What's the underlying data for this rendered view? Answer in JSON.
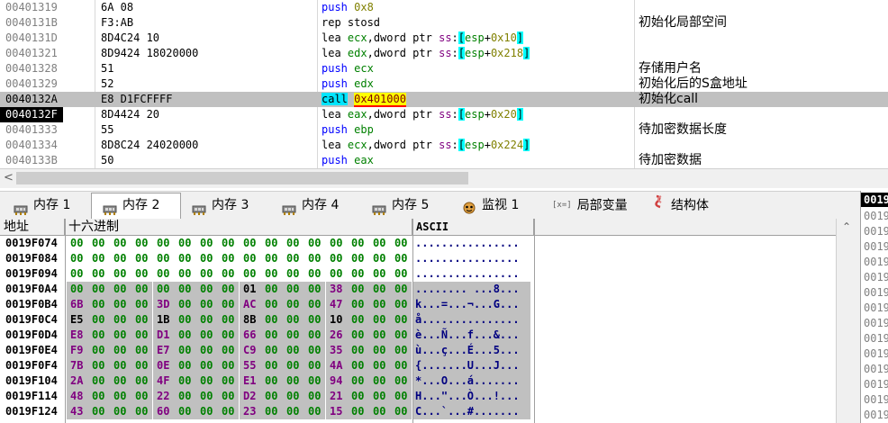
{
  "disasm": {
    "rows": [
      {
        "addr": "00401319",
        "bytes": "6A 08",
        "mn": "push",
        "ops": [
          [
            "num",
            "0x8"
          ]
        ],
        "comment": ""
      },
      {
        "addr": "0040131B",
        "bytes": "F3:AB",
        "mn": "rep stosd",
        "ops": [],
        "comment": "初始化局部空间"
      },
      {
        "addr": "0040131D",
        "bytes": "8D4C24 10",
        "mn": "lea",
        "ops": [
          [
            "reg",
            "ecx"
          ],
          [
            "k",
            ",dword ptr "
          ],
          [
            "seg",
            "ss"
          ],
          [
            "k",
            ":"
          ],
          [
            "br",
            "["
          ],
          [
            "reg",
            "esp"
          ],
          [
            "k",
            "+"
          ],
          [
            "num",
            "0x10"
          ],
          [
            "br",
            "]"
          ]
        ],
        "comment": ""
      },
      {
        "addr": "00401321",
        "bytes": "8D9424 18020000",
        "mn": "lea",
        "ops": [
          [
            "reg",
            "edx"
          ],
          [
            "k",
            ",dword ptr "
          ],
          [
            "seg",
            "ss"
          ],
          [
            "k",
            ":"
          ],
          [
            "br",
            "["
          ],
          [
            "reg",
            "esp"
          ],
          [
            "k",
            "+"
          ],
          [
            "num",
            "0x218"
          ],
          [
            "br",
            "]"
          ]
        ],
        "comment": ""
      },
      {
        "addr": "00401328",
        "bytes": "51",
        "mn": "push",
        "ops": [
          [
            "reg",
            "ecx"
          ]
        ],
        "comment": "存储用户名"
      },
      {
        "addr": "00401329",
        "bytes": "52",
        "mn": "push",
        "ops": [
          [
            "reg",
            "edx"
          ]
        ],
        "comment": "初始化后的S盒地址"
      },
      {
        "addr": "0040132A",
        "bytes": "E8 D1FCFFFF",
        "mn": "call",
        "ops": [
          [
            "tgt",
            "0x401000"
          ]
        ],
        "comment": "初始化call"
      },
      {
        "addr": "0040132F",
        "bytes": "8D4424 20",
        "mn": "lea",
        "ops": [
          [
            "reg",
            "eax"
          ],
          [
            "k",
            ",dword ptr "
          ],
          [
            "seg",
            "ss"
          ],
          [
            "k",
            ":"
          ],
          [
            "br",
            "["
          ],
          [
            "reg",
            "esp"
          ],
          [
            "k",
            "+"
          ],
          [
            "num",
            "0x20"
          ],
          [
            "br",
            "]"
          ]
        ],
        "comment": ""
      },
      {
        "addr": "00401333",
        "bytes": "55",
        "mn": "push",
        "ops": [
          [
            "reg",
            "ebp"
          ]
        ],
        "comment": "待加密数据长度"
      },
      {
        "addr": "00401334",
        "bytes": "8D8C24 24020000",
        "mn": "lea",
        "ops": [
          [
            "reg",
            "ecx"
          ],
          [
            "k",
            ",dword ptr "
          ],
          [
            "seg",
            "ss"
          ],
          [
            "k",
            ":"
          ],
          [
            "br",
            "["
          ],
          [
            "reg",
            "esp"
          ],
          [
            "k",
            "+"
          ],
          [
            "num",
            "0x224"
          ],
          [
            "br",
            "]"
          ]
        ],
        "comment": ""
      },
      {
        "addr": "0040133B",
        "bytes": "50",
        "mn": "push",
        "ops": [
          [
            "reg",
            "eax"
          ]
        ],
        "comment": "待加密数据"
      }
    ],
    "selected_index": 6,
    "current_index": 7
  },
  "tabs": [
    {
      "label": "内存 1",
      "icon": "memory-icon",
      "active": false
    },
    {
      "label": "内存 2",
      "icon": "memory-icon",
      "active": true
    },
    {
      "label": "内存 3",
      "icon": "memory-icon",
      "active": false
    },
    {
      "label": "内存 4",
      "icon": "memory-icon",
      "active": false
    },
    {
      "label": "内存 5",
      "icon": "memory-icon",
      "active": false
    },
    {
      "label": "监视 1",
      "icon": "watch-icon",
      "active": false
    },
    {
      "label": "局部变量",
      "icon": "locals-icon",
      "active": false
    },
    {
      "label": "结构体",
      "icon": "struct-icon",
      "active": false
    }
  ],
  "locals_icon_text": "[x=]",
  "dump": {
    "headers": {
      "address": "地址",
      "hex": "十六进制",
      "ascii": "ASCII"
    },
    "rows": [
      {
        "addr": "0019F074",
        "hex": [
          "00",
          "00",
          "00",
          "00",
          "00",
          "00",
          "00",
          "00",
          "00",
          "00",
          "00",
          "00",
          "00",
          "00",
          "00",
          "00"
        ],
        "ascii": "................"
      },
      {
        "addr": "0019F084",
        "hex": [
          "00",
          "00",
          "00",
          "00",
          "00",
          "00",
          "00",
          "00",
          "00",
          "00",
          "00",
          "00",
          "00",
          "00",
          "00",
          "00"
        ],
        "ascii": "................"
      },
      {
        "addr": "0019F094",
        "hex": [
          "00",
          "00",
          "00",
          "00",
          "00",
          "00",
          "00",
          "00",
          "00",
          "00",
          "00",
          "00",
          "00",
          "00",
          "00",
          "00"
        ],
        "ascii": "................"
      },
      {
        "addr": "0019F0A4",
        "hex": [
          "00",
          "00",
          "00",
          "00",
          "00",
          "00",
          "00",
          "00",
          "01",
          "00",
          "00",
          "00",
          "38",
          "00",
          "00",
          "00"
        ],
        "ascii": "........ ...8..."
      },
      {
        "addr": "0019F0B4",
        "hex": [
          "6B",
          "00",
          "00",
          "00",
          "3D",
          "00",
          "00",
          "00",
          "AC",
          "00",
          "00",
          "00",
          "47",
          "00",
          "00",
          "00"
        ],
        "ascii": "k...=...¬...G..."
      },
      {
        "addr": "0019F0C4",
        "hex": [
          "E5",
          "00",
          "00",
          "00",
          "1B",
          "00",
          "00",
          "00",
          "8B",
          "00",
          "00",
          "00",
          "10",
          "00",
          "00",
          "00"
        ],
        "ascii": "å..............."
      },
      {
        "addr": "0019F0D4",
        "hex": [
          "E8",
          "00",
          "00",
          "00",
          "D1",
          "00",
          "00",
          "00",
          "66",
          "00",
          "00",
          "00",
          "26",
          "00",
          "00",
          "00"
        ],
        "ascii": "è...Ñ...f...&..."
      },
      {
        "addr": "0019F0E4",
        "hex": [
          "F9",
          "00",
          "00",
          "00",
          "E7",
          "00",
          "00",
          "00",
          "C9",
          "00",
          "00",
          "00",
          "35",
          "00",
          "00",
          "00"
        ],
        "ascii": "ù...ç...É...5..."
      },
      {
        "addr": "0019F0F4",
        "hex": [
          "7B",
          "00",
          "00",
          "00",
          "0E",
          "00",
          "00",
          "00",
          "55",
          "00",
          "00",
          "00",
          "4A",
          "00",
          "00",
          "00"
        ],
        "ascii": "{.......U...J..."
      },
      {
        "addr": "0019F104",
        "hex": [
          "2A",
          "00",
          "00",
          "00",
          "4F",
          "00",
          "00",
          "00",
          "E1",
          "00",
          "00",
          "00",
          "94",
          "00",
          "00",
          "00"
        ],
        "ascii": "*...O...á......."
      },
      {
        "addr": "0019F114",
        "hex": [
          "48",
          "00",
          "00",
          "00",
          "22",
          "00",
          "00",
          "00",
          "D2",
          "00",
          "00",
          "00",
          "21",
          "00",
          "00",
          "00"
        ],
        "ascii": "H...\"...Ò...!..."
      },
      {
        "addr": "0019F124",
        "hex": [
          "43",
          "00",
          "00",
          "00",
          "60",
          "00",
          "00",
          "00",
          "23",
          "00",
          "00",
          "00",
          "15",
          "00",
          "00",
          "00"
        ],
        "ascii": "C...`...#......."
      }
    ],
    "highlight_from_row": 3
  },
  "side_panel": {
    "top_label": "0019",
    "rows": [
      "0019",
      "0019",
      "0019",
      "0019",
      "0019",
      "0019",
      "0019",
      "0019",
      "0019",
      "0019",
      "0019",
      "0019",
      "0019",
      "0019"
    ]
  },
  "colors": {
    "selected_row": "#c0c0c0",
    "call_bg": "#00e5ff",
    "byte_green": "#008000",
    "byte_purple": "#800080",
    "dump_shade": "#c0c0c0"
  }
}
